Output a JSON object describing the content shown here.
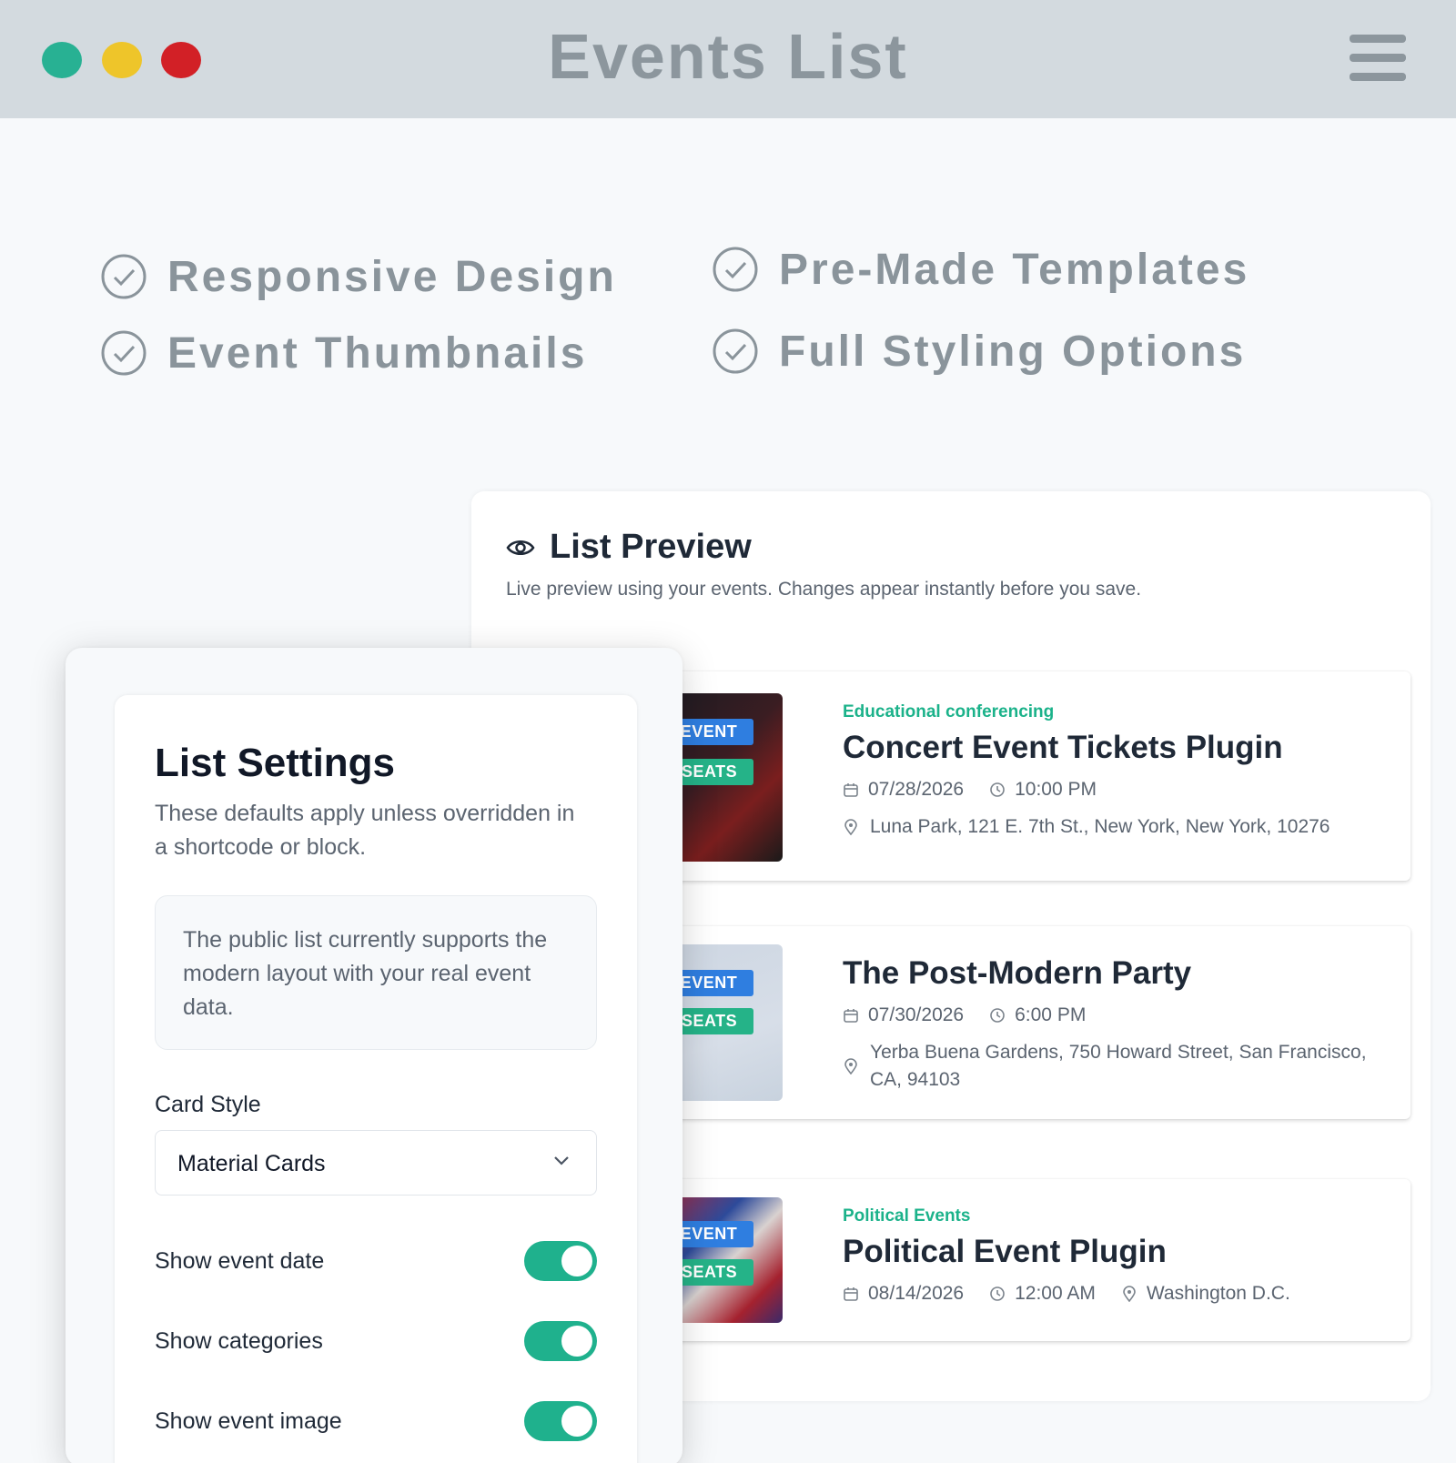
{
  "window": {
    "title": "Events List",
    "dots": [
      "#28b193",
      "#eec52a",
      "#d22026"
    ]
  },
  "features": [
    {
      "label": "Responsive Design"
    },
    {
      "label": "Pre-Made Templates"
    },
    {
      "label": "Event Thumbnails"
    },
    {
      "label": "Full Styling Options"
    }
  ],
  "preview": {
    "title": "List Preview",
    "subtitle": "Live preview using your events. Changes appear instantly before you save.",
    "events": [
      {
        "category": "Educational conferencing",
        "title": "Concert Event Tickets Plugin",
        "date": "07/28/2026",
        "time": "10:00 PM",
        "location": "Luna Park, 121 E. 7th St., New York, New York, 10276",
        "badge_top": "Y EVENT",
        "badge_bottom": "D SEATS"
      },
      {
        "category": "",
        "title": "The Post-Modern Party",
        "date": "07/30/2026",
        "time": "6:00 PM",
        "location": "Yerba Buena Gardens, 750 Howard Street, San Francisco, CA, 94103",
        "badge_top": "Y EVENT",
        "badge_bottom": "D SEATS"
      },
      {
        "category": "Political Events",
        "title": "Political Event Plugin",
        "date": "08/14/2026",
        "time": "12:00 AM",
        "location": "Washington D.C.",
        "badge_top": "Y EVENT",
        "badge_bottom": "D SEATS"
      }
    ]
  },
  "settings": {
    "title": "List Settings",
    "subtitle": "These defaults apply unless overridden in a shortcode or block.",
    "info": "The public list currently supports the modern layout with your real event data.",
    "card_style_label": "Card Style",
    "card_style_value": "Material Cards",
    "toggles": [
      {
        "label": "Show event date",
        "on": true
      },
      {
        "label": "Show categories",
        "on": true
      },
      {
        "label": "Show event image",
        "on": true
      }
    ]
  },
  "colors": {
    "accent": "#1fb18d",
    "category_text": "#1bb28a",
    "badge_blue": "#2f7ee0",
    "badge_green": "#25b388"
  }
}
